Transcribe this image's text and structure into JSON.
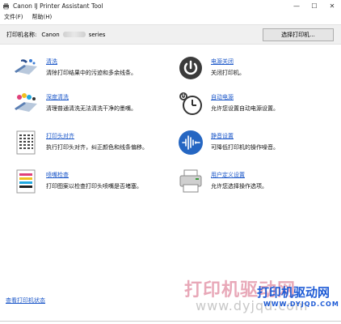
{
  "window": {
    "title": "Canon IJ Printer Assistant Tool",
    "controls": {
      "minimize": "—",
      "maximize": "☐",
      "close": "✕"
    }
  },
  "menu": {
    "file": "文件(F)",
    "help": "帮助(H)"
  },
  "printer": {
    "label": "打印机名称:",
    "name_prefix": "Canon",
    "name_suffix": "series",
    "select_button": "选择打印机..."
  },
  "tools_left": [
    {
      "name": "清洗",
      "desc": "清除打印结果中的污迹和多余线条。",
      "icon": "cleaning-icon"
    },
    {
      "name": "深度清洗",
      "desc": "清理普通清洗无法清洗干净的墨嘴。",
      "icon": "deep-cleaning-icon"
    },
    {
      "name": "打印头对齐",
      "desc": "执行打印头对齐，纠正颜色和线条偏移。",
      "icon": "print-head-alignment-icon"
    },
    {
      "name": "喷嘴检查",
      "desc": "打印图案以检查打印头喷嘴是否堵塞。",
      "icon": "nozzle-check-icon"
    }
  ],
  "tools_right": [
    {
      "name": "电源关闭",
      "desc": "关闭打印机。",
      "icon": "power-off-icon"
    },
    {
      "name": "自动电源",
      "desc": "允许您设置自动电源设置。",
      "icon": "auto-power-icon"
    },
    {
      "name": "静音设置",
      "desc": "可降低打印机的操作噪音。",
      "icon": "quiet-settings-icon"
    },
    {
      "name": "用户定义设置",
      "desc": "允许您选择操作选项。",
      "icon": "custom-settings-icon"
    }
  ],
  "status_link": "查看打印机状态",
  "watermark": {
    "text": "打印机驱动网",
    "url": "www.dyjqd.com",
    "logo_line1": "打印机驱动网",
    "logo_line2": "WWW.DYJQD.COM"
  }
}
